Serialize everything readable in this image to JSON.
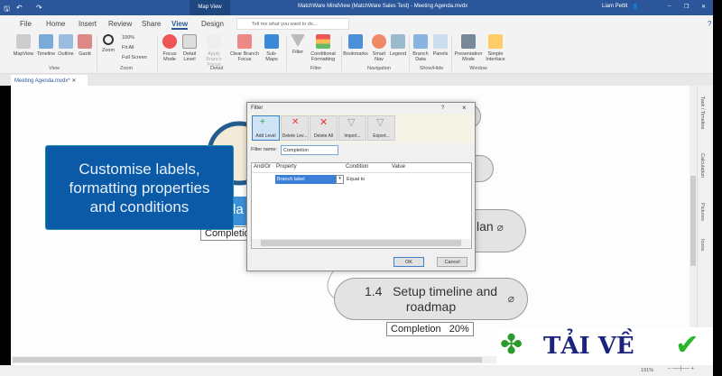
{
  "titlebar": {
    "context_tab": "Map View",
    "title": "MatchWare MindView (MatchWare Sales Test) - Meeting Agenda.mvdx",
    "user": "Liam Pettit"
  },
  "tabs": [
    "File",
    "Home",
    "Insert",
    "Review",
    "Share",
    "View",
    "Design"
  ],
  "active_tab": "View",
  "tell_me": "Tell me what you want to do...",
  "ribbon": {
    "groups": [
      {
        "label": "View",
        "buttons": [
          "MapView",
          "Timeline",
          "Outline",
          "Gantt"
        ]
      },
      {
        "label": "Zoom",
        "buttons": [
          "Zoom",
          "100%",
          "Fit All",
          "Full Screen"
        ]
      },
      {
        "label": "Detail",
        "buttons": [
          "Focus Mode",
          "Detail Level",
          "Apply Branch Focus",
          "Clear Branch Focus",
          "Sub-Maps"
        ]
      },
      {
        "label": "Filter",
        "buttons": [
          "Filter",
          "Conditional Formatting"
        ]
      },
      {
        "label": "Navigation",
        "buttons": [
          "Bookmarks",
          "Smart Nav",
          "Legend"
        ]
      },
      {
        "label": "Show/Hide",
        "buttons": [
          "Branch Data",
          "Panels"
        ]
      },
      {
        "label": "Window",
        "buttons": [
          "Presentation Mode",
          "Simple Interface"
        ]
      }
    ]
  },
  "document_tab": "Meeting Agenda.mvdx*",
  "side_panels": [
    "Task / Timeline",
    "Calculation",
    "Pictures",
    "Icons"
  ],
  "callout": {
    "line1": "Customise labels,",
    "line2": "formatting properties",
    "line3": "and conditions"
  },
  "map": {
    "partial_node": "la",
    "partial_completion": "Completion",
    "partial_node2": "lan",
    "node_1_4": {
      "number": "1.4",
      "line1": "Setup timeline and",
      "line2": "roadmap"
    },
    "completion": "Completion   20%"
  },
  "dialog": {
    "title": "Filter",
    "help": "?",
    "close": "×",
    "toolbar": [
      "Add Level",
      "Delete Lev...",
      "Delete All",
      "Import...",
      "Export..."
    ],
    "filter_name_label": "Filter name:",
    "filter_name_value": "Completion",
    "columns": [
      "And/Or",
      "Property",
      "Condition",
      "Value"
    ],
    "row": {
      "and_or": "",
      "property": "Branch label",
      "condition": "Equal to",
      "value": ""
    },
    "ok": "OK",
    "cancel": "Cancel"
  },
  "status": {
    "zoom": "191%"
  },
  "watermark": "TẢI VỀ"
}
